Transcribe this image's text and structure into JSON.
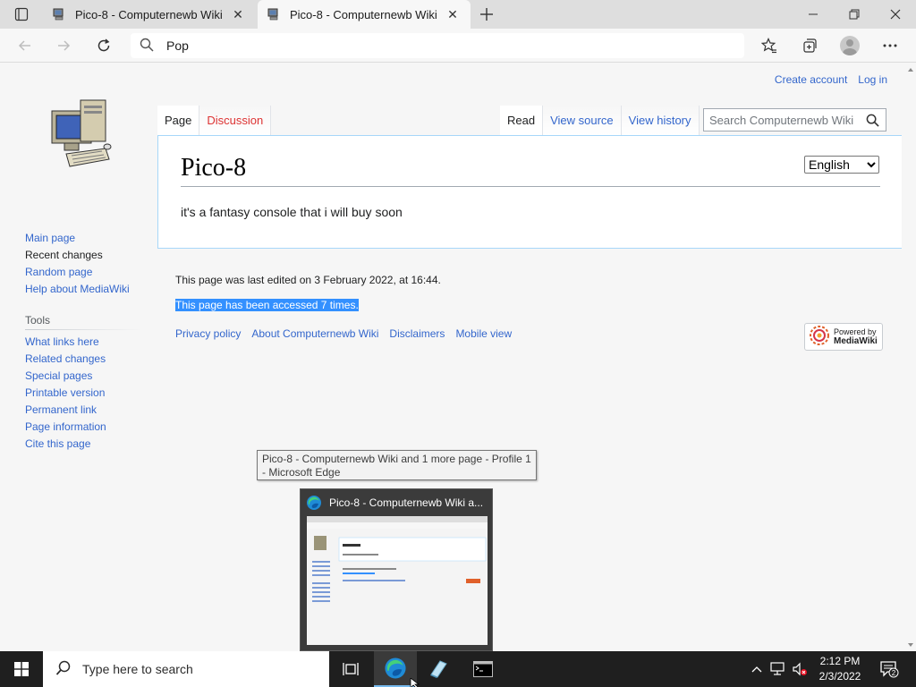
{
  "browser": {
    "tabs": [
      {
        "title": "Pico-8 - Computernewb Wiki"
      },
      {
        "title": "Pico-8 - Computernewb Wiki"
      }
    ],
    "address_value": "Pop"
  },
  "page": {
    "personal": {
      "create_account": "Create account",
      "log_in": "Log in"
    },
    "sidebar": {
      "nav": [
        {
          "label": "Main page"
        },
        {
          "label": "Recent changes"
        },
        {
          "label": "Random page"
        },
        {
          "label": "Help about MediaWiki"
        }
      ],
      "tools_heading": "Tools",
      "tools": [
        {
          "label": "What links here"
        },
        {
          "label": "Related changes"
        },
        {
          "label": "Special pages"
        },
        {
          "label": "Printable version"
        },
        {
          "label": "Permanent link"
        },
        {
          "label": "Page information"
        },
        {
          "label": "Cite this page"
        }
      ]
    },
    "tabs_left": {
      "page": "Page",
      "discussion": "Discussion"
    },
    "tabs_right": {
      "read": "Read",
      "view_source": "View source",
      "view_history": "View history"
    },
    "search_placeholder": "Search Computernewb Wiki",
    "title": "Pico-8",
    "language": "English",
    "body": "it's a fantasy console that i will buy soon",
    "footer": {
      "last_edited": "This page was last edited on 3 February 2022, at 16:44.",
      "accessed": "This page has been accessed 7 times.",
      "links": [
        {
          "label": "Privacy policy"
        },
        {
          "label": "About Computernewb Wiki"
        },
        {
          "label": "Disclaimers"
        },
        {
          "label": "Mobile view"
        }
      ],
      "powered_line1": "Powered by",
      "powered_line2": "MediaWiki"
    }
  },
  "tooltip": "Pico-8 - Computernewb Wiki and 1 more page - Profile 1 - Microsoft Edge",
  "thumbnail_title": "Pico-8 - Computernewb Wiki a...",
  "taskbar": {
    "search_placeholder": "Type here to search",
    "time": "2:12 PM",
    "date": "2/3/2022",
    "notification_count": "2"
  },
  "colors": {
    "link": "#3366cc",
    "selection": "#3390ff",
    "taskbar": "#1f1f1f"
  }
}
